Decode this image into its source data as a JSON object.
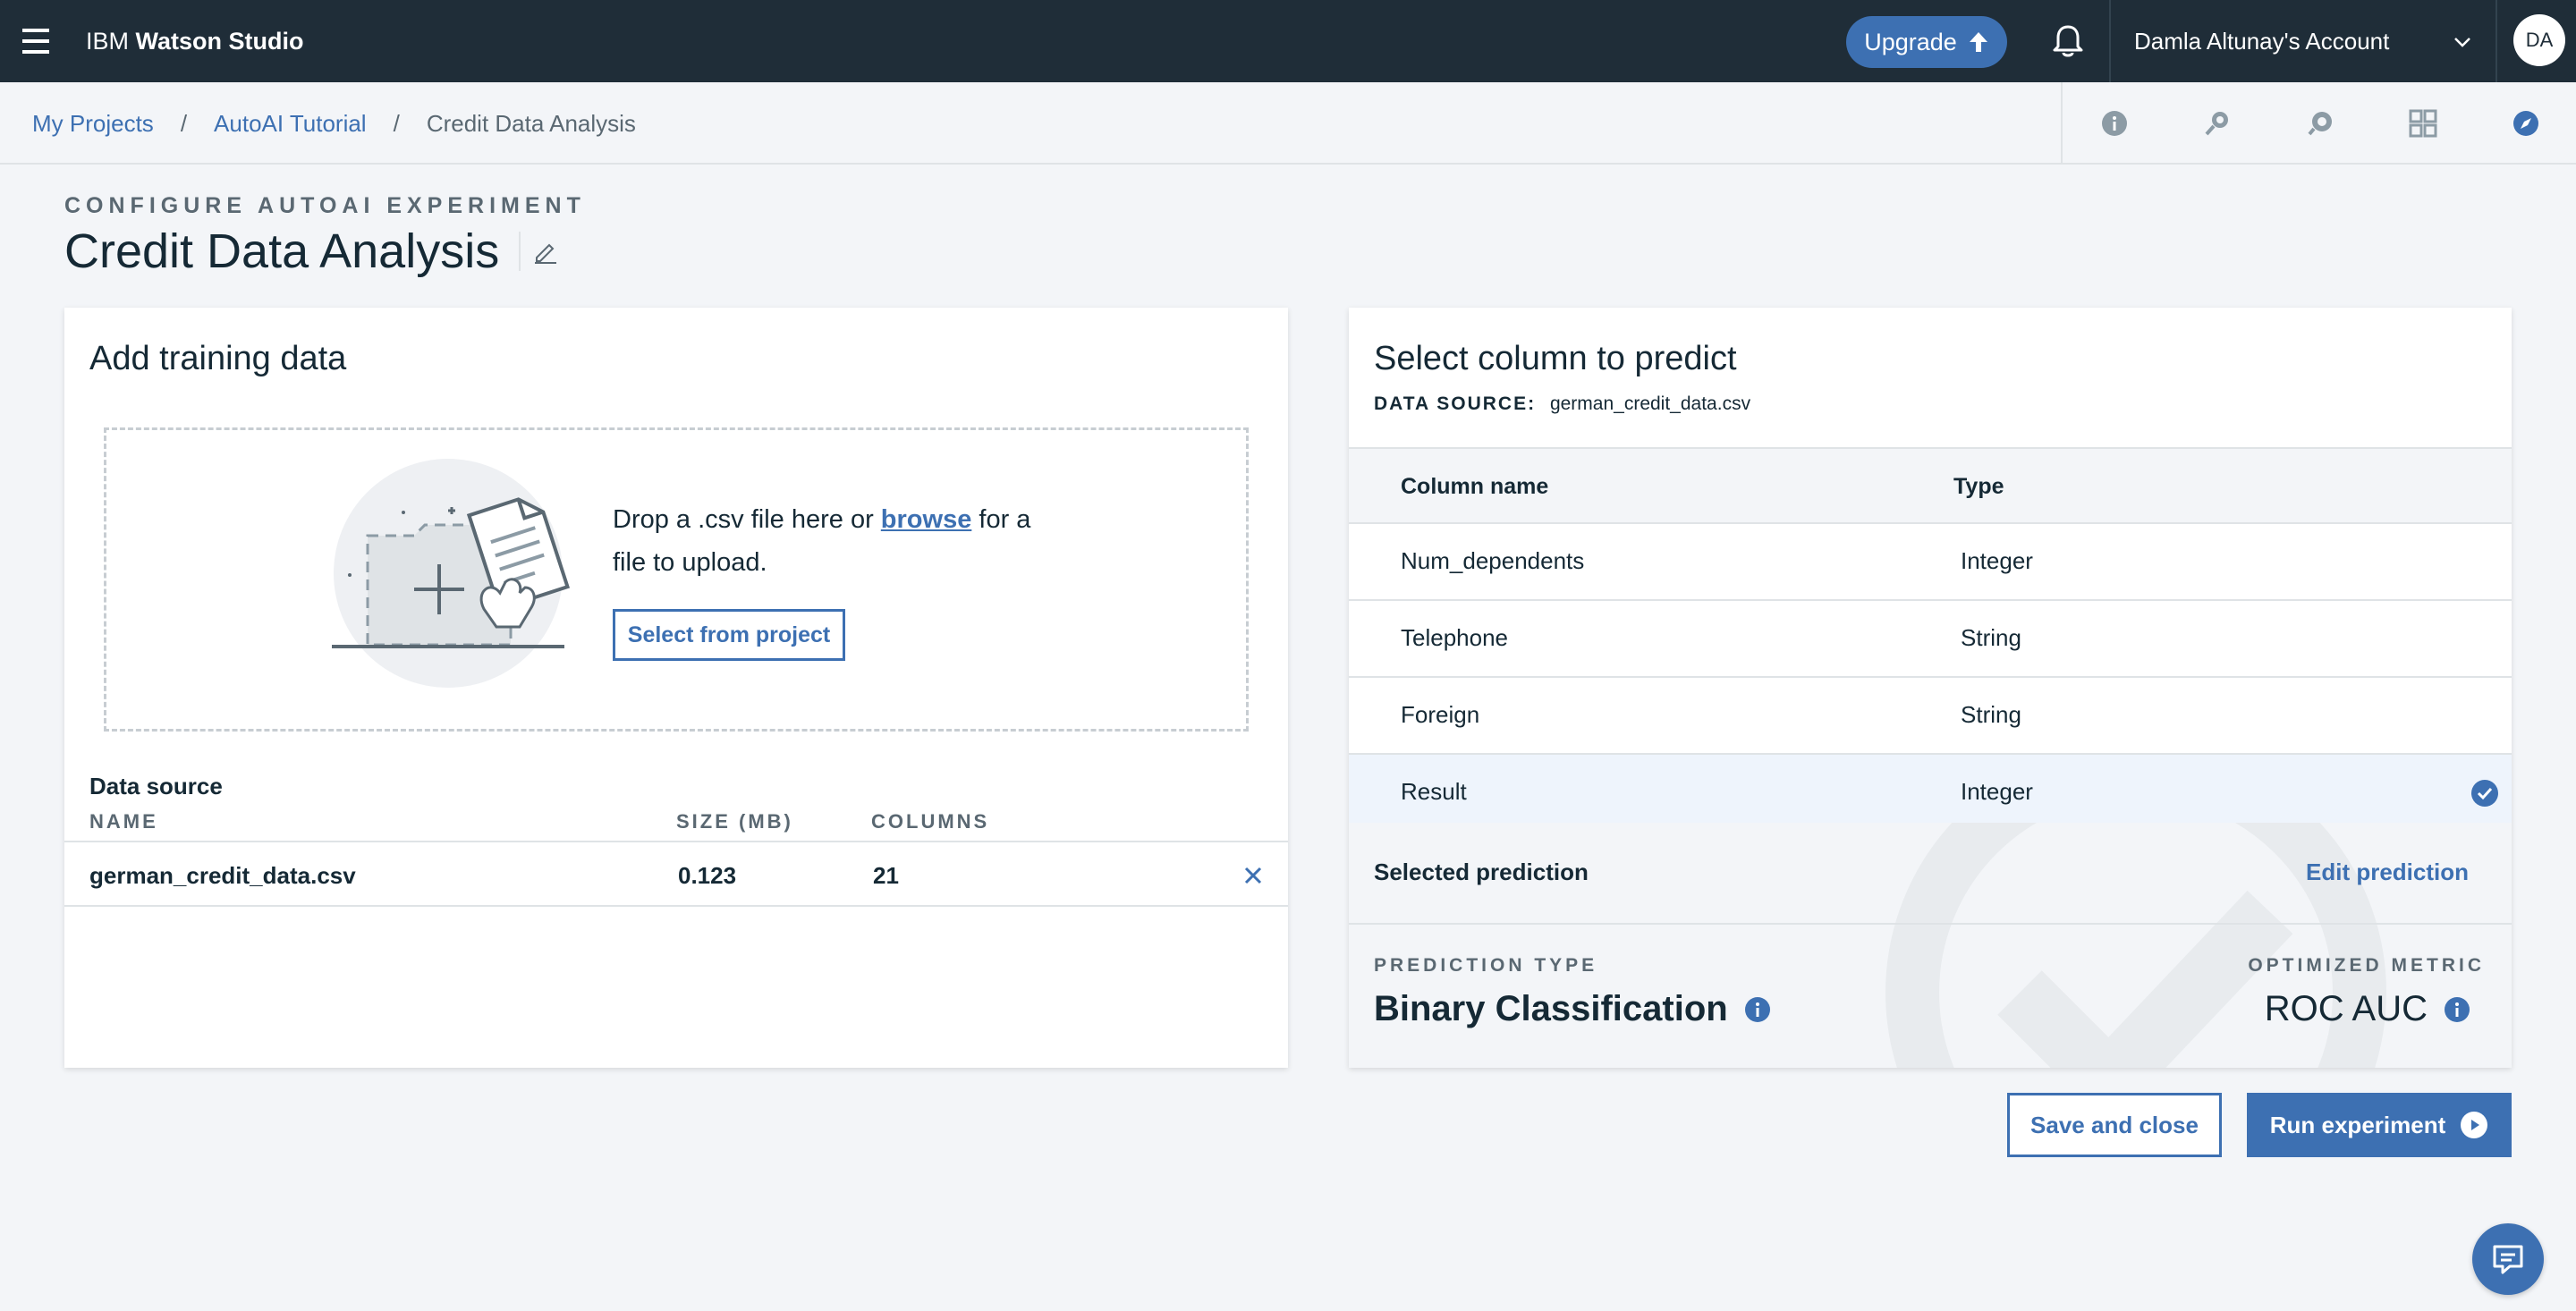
{
  "topbar": {
    "brand_prefix": "IBM",
    "brand_name": "Watson Studio",
    "upgrade_label": "Upgrade",
    "account_name": "Damla Altunay's Account",
    "avatar_initials": "DA"
  },
  "breadcrumb": {
    "items": [
      "My Projects",
      "AutoAI Tutorial"
    ],
    "current": "Credit Data Analysis",
    "separator": "/"
  },
  "header": {
    "eyebrow": "CONFIGURE AUTOAI EXPERIMENT",
    "title": "Credit Data Analysis"
  },
  "training": {
    "title": "Add training data",
    "drop_prefix": "Drop a .csv file here or ",
    "browse_link": "browse",
    "drop_suffix": " for a file to upload.",
    "select_from_project": "Select from project",
    "data_source_label": "Data source",
    "columns": [
      "NAME",
      "SIZE (MB)",
      "COLUMNS"
    ],
    "file": {
      "name": "german_credit_data.csv",
      "size": "0.123",
      "columns": "21"
    }
  },
  "predict": {
    "title": "Select column to predict",
    "source_label": "DATA SOURCE:",
    "source_value": "german_credit_data.csv",
    "col_header_name": "Column name",
    "col_header_type": "Type",
    "rows": [
      {
        "name": "Num_dependents",
        "type": "Integer"
      },
      {
        "name": "Telephone",
        "type": "String"
      },
      {
        "name": "Foreign",
        "type": "String"
      },
      {
        "name": "Result",
        "type": "Integer",
        "selected": true
      }
    ],
    "selected_prediction_label": "Selected prediction",
    "edit_prediction": "Edit prediction",
    "prediction_type_label": "PREDICTION TYPE",
    "prediction_type": "Binary Classification",
    "optimized_metric_label": "OPTIMIZED METRIC",
    "optimized_metric": "ROC AUC"
  },
  "actions": {
    "save_close": "Save and close",
    "run_experiment": "Run experiment"
  },
  "colors": {
    "accent": "#3d70b2",
    "topbar": "#1f2d38",
    "background": "#f3f5f8"
  }
}
